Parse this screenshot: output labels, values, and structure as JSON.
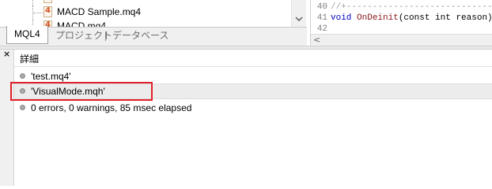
{
  "navigator": {
    "tree_items": [
      {
        "label": "MACD Sample.mq4",
        "icon": "mq4-file-icon",
        "icon_glyph": "4"
      },
      {
        "label": "MACD.mq4",
        "icon": "mq4-file-icon",
        "icon_glyph": "4"
      }
    ],
    "tabs": [
      {
        "label": "MQL4",
        "active": true
      },
      {
        "label": "プロジェクト",
        "active": false
      },
      {
        "label": "データベース",
        "active": false
      }
    ]
  },
  "editor": {
    "lines": [
      {
        "num": "40",
        "comment": "//+------------------------------------------"
      },
      {
        "num": "41",
        "kw1": "void",
        "fn": "OnDeinit",
        "rest": "(const int reason)"
      },
      {
        "num": "42"
      }
    ],
    "scroll_arrow": "<"
  },
  "toolbox": {
    "close_glyph": "×",
    "column_header": "詳細",
    "messages": [
      {
        "text": "'test.mq4'",
        "selected": false
      },
      {
        "text": "'VisualMode.mqh'",
        "selected": true
      },
      {
        "text": "0 errors, 0 warnings, 85 msec elapsed",
        "selected": false
      }
    ],
    "highlight_color": "#e0202a"
  }
}
